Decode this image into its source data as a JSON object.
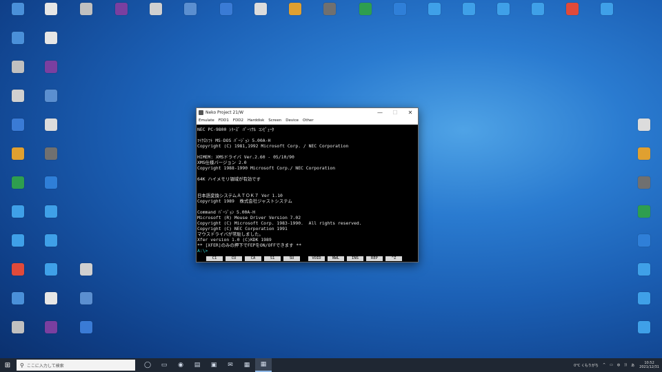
{
  "window": {
    "title": "Neko Project 21/W",
    "minimize": "—",
    "maximize": "☐",
    "close": "✕",
    "menus": [
      "Emulate",
      "FDD1",
      "FDD2",
      "Harddisk",
      "Screen",
      "Device",
      "Other"
    ]
  },
  "screen": {
    "lines": [
      "NEC PC-9800 ｼﾘｰｽﾞ ﾊﾟｰｿﾅﾙ ｺﾝﾋﾟｭｰﾀ",
      "",
      "ﾏｲｸﾛｿﾌﾄ MS-DOS ﾊﾞｰｼﾞｮﾝ 5.00A-H",
      "Copyright (C) 1981,1992 Microsoft Corp. / NEC Corporation",
      "",
      "HIMEM: XMSドライバ Ver.2.60 - 05/10/90",
      "XMS仕様バージョン 2.0",
      "Copyright 1988-1990 Microsoft Corp./ NEC Corporation",
      "",
      "64K ハイメモリ領域が有効です",
      "",
      "",
      "日本語変換システムＡＴＯＫ７ Ver 1.10",
      "Copyright 1989  株式会社ジャストシステム",
      "",
      "Command ﾊﾞｰｼﾞｮﾝ 5.00A-H",
      "Microsoft (R) Mouse Driver Version 7.02",
      "Copyright (C) Microsoft Corp. 1983-1990.  All rights reserved.",
      "Copyright (C) NEC Corporation 1991",
      "マウスドライバが常駐しました。",
      "Xfer version 1.0 (C)KDK 1989",
      "** [XFER]のみの押下でFEPをON/OFFできます **"
    ],
    "prompt": "A:\\>",
    "fkeys": [
      "C1",
      "CU",
      "CA",
      "S1",
      "SU",
      "VOID",
      "NWL",
      "INS",
      "REP",
      "^Z"
    ]
  },
  "taskbar": {
    "start": "⊞",
    "search_placeholder": "ここに入力して検索",
    "search_icon": "⚲",
    "buttons": [
      "◯",
      "▭",
      "◉",
      "▤",
      "▣",
      "✉",
      "▦",
      "▦"
    ],
    "tray_text": "0°C くもりがち",
    "tray_icons": [
      "^",
      "▭",
      "◍",
      "))",
      "あ"
    ],
    "time": "10:52",
    "date": "2021/12/31"
  },
  "desktop": {
    "icon_colors": [
      "#4a90d9",
      "#e6e6e6",
      "#c0c0c0",
      "#7a3fa0",
      "#d0d0d0",
      "#5b8fd0",
      "#3a7bd5",
      "#dcdcdc",
      "#e0a030",
      "#707070",
      "#2e9e4f",
      "#2f7fd8",
      "#3fa0e8",
      "#3fa0e8",
      "#3fa0e8",
      "#3fa0e8",
      "#e04a3a",
      "#3fa0e8"
    ]
  }
}
